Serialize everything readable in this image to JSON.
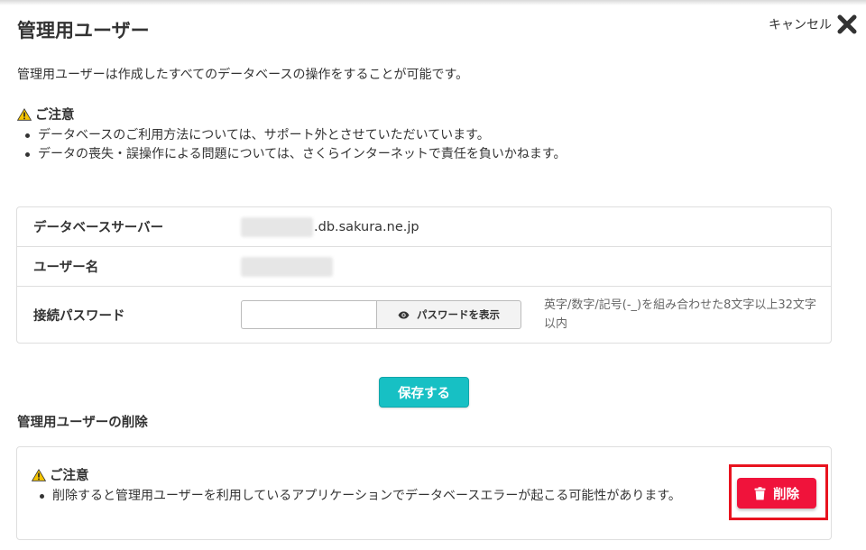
{
  "header": {
    "title": "管理用ユーザー",
    "cancel_label": "キャンセル"
  },
  "intro": "管理用ユーザーは作成したすべてのデータベースの操作をすることが可能です。",
  "notice": {
    "title": "ご注意",
    "items": [
      "データベースのご利用方法については、サポート外とさせていただいています。",
      "データの喪失・誤操作による問題については、さくらインターネットで責任を負いかねます。"
    ]
  },
  "details": {
    "server_label": "データベースサーバー",
    "server_value": ".db.sakura.ne.jp",
    "username_label": "ユーザー名",
    "password_label": "接続パスワード",
    "password_value": "",
    "password_placeholder": "",
    "show_password_label": "パスワードを表示",
    "password_hint": "英字/数字/記号(-_)を組み合わせた8文字以上32文字以内"
  },
  "save_label": "保存する",
  "delete_section": {
    "title": "管理用ユーザーの削除",
    "notice_title": "ご注意",
    "notice_items": [
      "削除すると管理用ユーザーを利用しているアプリケーションでデータベースエラーが起こる可能性があります。"
    ],
    "delete_label": "削除"
  },
  "colors": {
    "save_button": "#17c0c4",
    "delete_button": "#f0133b",
    "highlight": "#e8131f",
    "warning": "#f5c400"
  },
  "icons": [
    "close-icon",
    "warning-icon",
    "eye-icon",
    "trash-icon"
  ]
}
